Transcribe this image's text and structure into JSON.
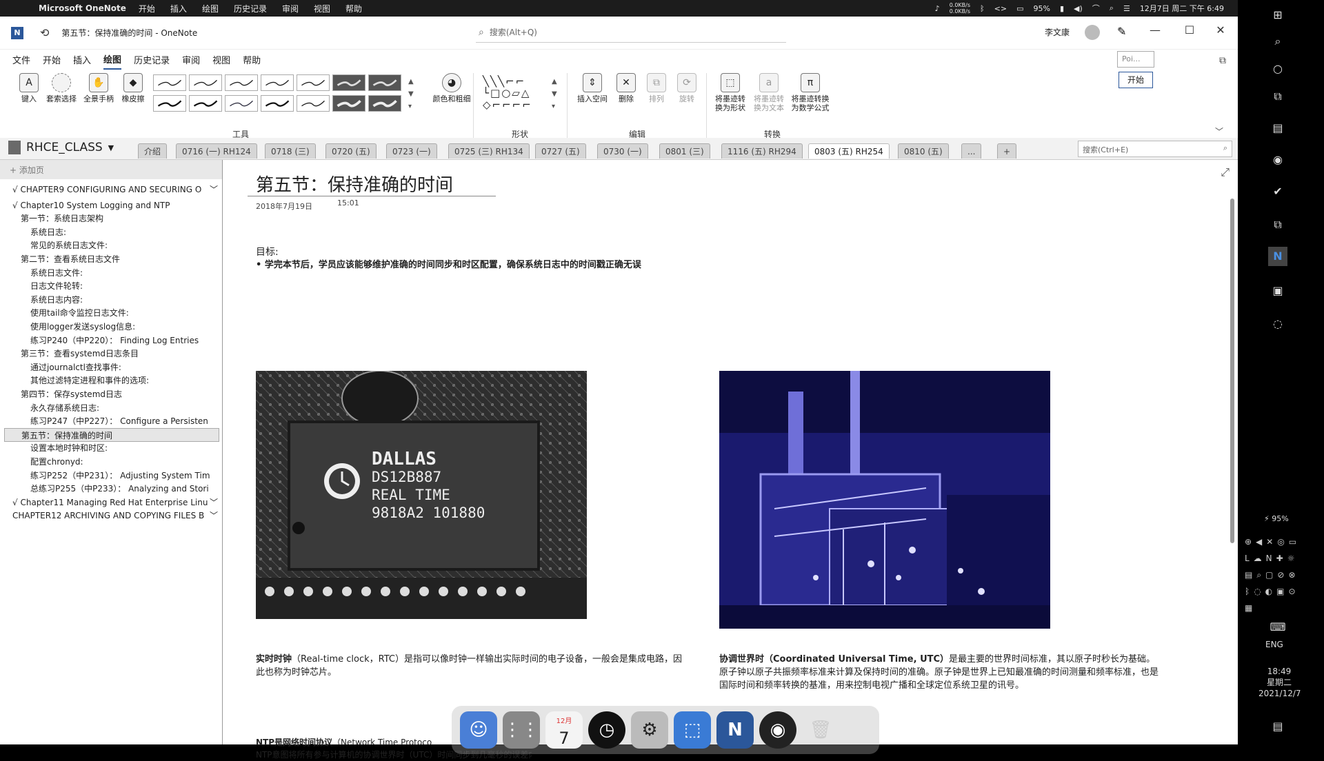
{
  "macbar": {
    "app_name": "Microsoft OneNote",
    "menus": [
      "开始",
      "插入",
      "绘图",
      "历史记录",
      "审阅",
      "视图",
      "帮助"
    ],
    "net_up": "0.0KB/s",
    "net_down": "0.0KB/s",
    "battery": "95%",
    "datetime": "12月7日 周二 下午 6:49"
  },
  "titlebar": {
    "doc_title": "第五节：保持准确的时间  -  OneNote",
    "search_placeholder": "搜索(Alt+Q)",
    "user_name": "李文康",
    "minimize": "—",
    "maximize": "☐",
    "close": "✕"
  },
  "tabs": [
    "文件",
    "开始",
    "插入",
    "绘图",
    "历史记录",
    "审阅",
    "视图",
    "帮助"
  ],
  "active_tab": "绘图",
  "overlay": {
    "poi_text": "Poi...",
    "start_text": "开始"
  },
  "ribbon": {
    "type_btn": "键入",
    "lasso_btn": "套索选择",
    "pan_btn": "全景手柄",
    "eraser_btn": "橡皮擦",
    "color_btn": "颜色和粗细",
    "insert_space_btn": "插入空间",
    "delete_btn": "删除",
    "arrange_btn": "排列",
    "rotate_btn": "旋转",
    "ink_to_shape_btn": "将墨迹转换为形状",
    "ink_to_text_btn": "将墨迹转换为文本",
    "ink_to_math_btn": "将墨迹转换为数学公式",
    "group_tools": "工具",
    "group_shapes": "形状",
    "group_edit": "编辑",
    "group_convert": "转换"
  },
  "notebook": {
    "name": "RHCE_CLASS",
    "section_tabs": [
      "介绍",
      "0716 (一) RH124",
      "0718 (三)",
      "0720 (五)",
      "0723 (一)",
      "0725 (三) RH134",
      "0727 (五)",
      "0730 (一)",
      "0801 (三)",
      "1116 (五) RH294",
      "0803 (五) RH254",
      "0810 (五)",
      "...",
      "+"
    ],
    "active_section": "0803 (五) RH254",
    "search_placeholder": "搜索(Ctrl+E)"
  },
  "pagelist": {
    "add_page": "添加页",
    "items": [
      {
        "label": "√ CHAPTER9 CONFIGURING AND SECURING O",
        "level": 0,
        "chev": "﹀"
      },
      {
        "label": "√ Chapter10 System Logging and NTP",
        "level": 0,
        "chev": ""
      },
      {
        "label": "第一节：系统日志架构",
        "level": 1,
        "chev": ""
      },
      {
        "label": "系统日志:",
        "level": 2,
        "chev": ""
      },
      {
        "label": "常见的系统日志文件:",
        "level": 2,
        "chev": ""
      },
      {
        "label": "第二节：查看系统日志文件",
        "level": 1,
        "chev": ""
      },
      {
        "label": "系统日志文件:",
        "level": 2,
        "chev": ""
      },
      {
        "label": "日志文件轮转:",
        "level": 2,
        "chev": ""
      },
      {
        "label": "系统日志内容:",
        "level": 2,
        "chev": ""
      },
      {
        "label": "使用tail命令监控日志文件:",
        "level": 2,
        "chev": ""
      },
      {
        "label": "使用logger发送syslog信息:",
        "level": 2,
        "chev": ""
      },
      {
        "label": "练习P240（中P220）：  Finding Log Entries",
        "level": 2,
        "chev": ""
      },
      {
        "label": "第三节：查看systemd日志条目",
        "level": 1,
        "chev": ""
      },
      {
        "label": "通过journalctl查找事件:",
        "level": 2,
        "chev": ""
      },
      {
        "label": "其他过滤特定进程和事件的选项:",
        "level": 2,
        "chev": ""
      },
      {
        "label": "第四节：保存systemd日志",
        "level": 1,
        "chev": ""
      },
      {
        "label": "永久存储系统日志:",
        "level": 2,
        "chev": ""
      },
      {
        "label": "练习P247（中P227）：  Configure a Persisten",
        "level": 2,
        "chev": ""
      },
      {
        "label": "第五节：保持准确的时间",
        "level": 1,
        "chev": "",
        "selected": true
      },
      {
        "label": "设置本地时钟和时区:",
        "level": 2,
        "chev": ""
      },
      {
        "label": "配置chronyd:",
        "level": 2,
        "chev": ""
      },
      {
        "label": "练习P252（中P231）：  Adjusting System Tim",
        "level": 2,
        "chev": ""
      },
      {
        "label": "总练习P255（中P233）：  Analyzing and Stori",
        "level": 2,
        "chev": ""
      },
      {
        "label": "√ Chapter11 Managing Red Hat Enterprise Linu",
        "level": 0,
        "chev": "﹀"
      },
      {
        "label": "CHAPTER12 ARCHIVING AND COPYING FILES B",
        "level": 0,
        "chev": "﹀"
      }
    ]
  },
  "page": {
    "title": "第五节：保持准确的时间",
    "date": "2018年7月19日",
    "time": "15:01",
    "goal_label": "目标:",
    "goal_text": "• 学完本节后，学员应该能够维护准确的时间同步和时区配置，确保系统日志中的时间戳正确无误",
    "chip_brand": "DALLAS",
    "chip_model": "DS12B887",
    "chip_desc": "REAL TIME",
    "chip_code": "9818A2  101880",
    "rtc_bold": "实时时钟",
    "rtc_text": "（Real-time clock，RTC）是指可以像时钟一样输出实际时间的电子设备，一般会是集成电路，因此也称为时钟芯片。",
    "utc_bold": "协调世界时（Coordinated Universal Time, UTC）",
    "utc_text": "是最主要的世界时间标准，其以原子时秒长为基础。原子钟以原子共振频率标准来计算及保持时间的准确。原子钟是世界上已知最准确的时间测量和频率标准，也是国际时间和频率转换的基准，用来控制电视广播和全球定位系统卫星的讯号。",
    "ntp_bold": "NTP是网络时间协议",
    "ntp_text": "（Network Time Protoco",
    "ntp_line2": "NTP意图将所有参与计算机的协调世界时（UTC）时间同步到几毫秒的误差内。"
  },
  "dock": {
    "calendar_month": "12月",
    "calendar_day": "7"
  },
  "taskbar": {
    "battery": "95%",
    "lang": "ENG",
    "time": "18:49",
    "weekday": "星期二",
    "date": "2021/12/7"
  }
}
